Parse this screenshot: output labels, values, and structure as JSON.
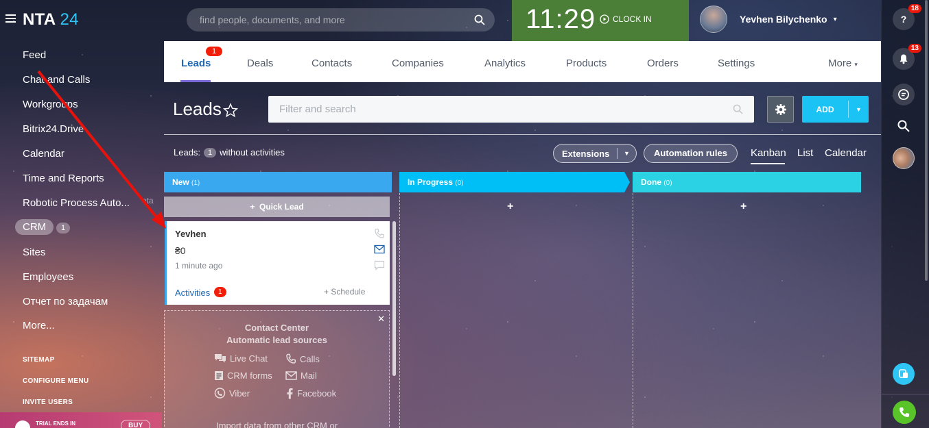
{
  "app": {
    "logo_main": "NTA",
    "logo_num": "24"
  },
  "search": {
    "placeholder": "find people, documents, and more"
  },
  "clock": {
    "time": "11:29",
    "clock_in_label": "CLOCK IN"
  },
  "user": {
    "name": "Yevhen Bilychenko"
  },
  "rail": {
    "help_badge": "18",
    "notifications_badge": "13"
  },
  "menu": {
    "items": [
      "Feed",
      "Chat and Calls",
      "Workgroups",
      "Bitrix24.Drive",
      "Calendar",
      "Time and Reports",
      "Robotic Process Auto...",
      "CRM",
      "Sites",
      "Employees",
      "Отчет по задачам",
      "More..."
    ],
    "crm_count": "1",
    "beta": "eta",
    "sitemap": "SITEMAP",
    "configure_menu": "CONFIGURE MENU",
    "invite_users": "INVITE USERS",
    "trial_text": "TRIAL ENDS IN",
    "buy_label": "BUY"
  },
  "tabs": {
    "items": [
      "Leads",
      "Deals",
      "Contacts",
      "Companies",
      "Analytics",
      "Products",
      "Orders",
      "Settings",
      "More"
    ],
    "leads_badge": "1"
  },
  "page": {
    "title": "Leads",
    "filter_placeholder": "Filter and search",
    "add_label": "ADD",
    "leads_label": "Leads:",
    "leads_count": "1",
    "without_activities": "without activities",
    "extensions_label": "Extensions",
    "automation_label": "Automation rules",
    "views": [
      "Kanban",
      "List",
      "Calendar"
    ]
  },
  "kanban": {
    "columns": [
      {
        "title": "New",
        "count": "(1)",
        "color": "#39a8ef"
      },
      {
        "title": "In Progress",
        "count": "(0)",
        "color": "#00bef6"
      },
      {
        "title": "Done",
        "count": "(0)",
        "color": "#2bd2e3"
      }
    ],
    "quick_lead_label": "Quick Lead",
    "card": {
      "name": "Yevhen",
      "price": "₴0",
      "time_ago": "1 minute ago",
      "activities_label": "Activities",
      "activities_count": "1",
      "schedule_label": "+ Schedule"
    },
    "contact_center": {
      "title": "Contact Center",
      "subtitle": "Automatic lead sources",
      "sources": [
        "Live Chat",
        "Calls",
        "CRM forms",
        "Mail",
        "Viber",
        "Facebook"
      ],
      "import_text": "Import data from other CRM or"
    }
  },
  "colors": {
    "accent": "#2fc6f6",
    "clock_bg": "#4b7e37",
    "badge": "#f11e0a"
  }
}
